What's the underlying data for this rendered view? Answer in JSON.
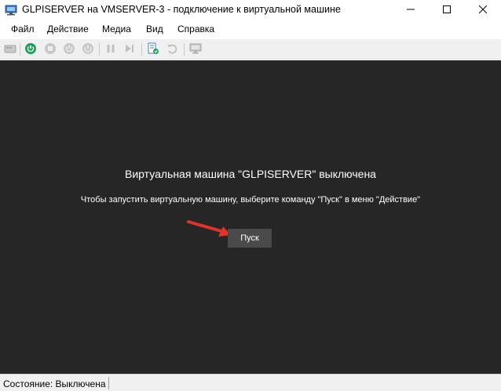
{
  "window": {
    "title": "GLPISERVER на VMSERVER-3 - подключение к виртуальной машине",
    "app_icon": "vm-connect-icon",
    "controls": [
      "minimize-icon",
      "maximize-icon",
      "close-icon"
    ]
  },
  "menu": {
    "items": [
      "Файл",
      "Действие",
      "Медиа",
      "Вид",
      "Справка"
    ]
  },
  "toolbar": {
    "buttons": [
      {
        "icon": "ctrl-alt-del-icon",
        "enabled": false
      },
      {
        "icon": "start-icon",
        "enabled": true
      },
      {
        "icon": "turn-off-icon",
        "enabled": false
      },
      {
        "icon": "shutdown-icon",
        "enabled": false
      },
      {
        "icon": "save-icon",
        "enabled": false
      },
      {
        "icon": "pause-icon",
        "enabled": false
      },
      {
        "icon": "reset-icon",
        "enabled": false
      },
      {
        "icon": "checkpoint-icon",
        "enabled": true
      },
      {
        "icon": "revert-icon",
        "enabled": false
      },
      {
        "icon": "enhanced-session-icon",
        "enabled": false
      }
    ]
  },
  "vm": {
    "status_title": "Виртуальная машина \"GLPISERVER\" выключена",
    "hint": "Чтобы запустить виртуальную машину, выберите команду \"Пуск\" в меню \"Действие\"",
    "start_label": "Пуск",
    "background_color": "#262626",
    "annotation": "red-arrow-icon"
  },
  "status": {
    "text": "Состояние: Выключена"
  },
  "colors": {
    "accent_green": "#1e9e5a",
    "arrow_red": "#e0342b"
  }
}
